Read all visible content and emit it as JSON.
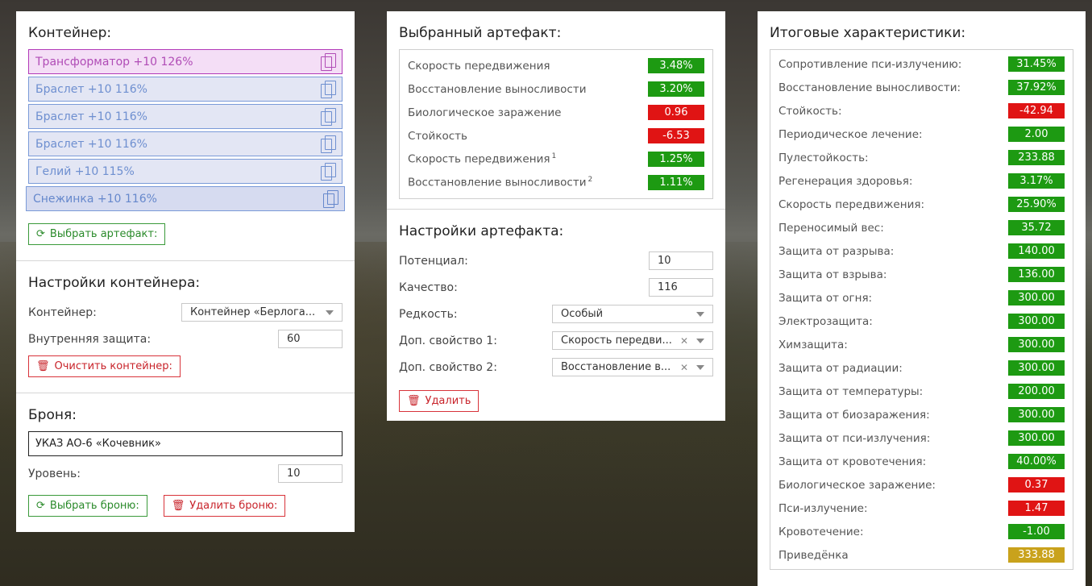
{
  "container_panel": {
    "title": "Контейнер:",
    "slots": [
      {
        "label": "Трансформатор +10 126%",
        "kind": "transformer"
      },
      {
        "label": "Браслет +10 116%",
        "kind": "normal"
      },
      {
        "label": "Браслет +10 116%",
        "kind": "normal"
      },
      {
        "label": "Браслет +10 116%",
        "kind": "normal"
      },
      {
        "label": "Гелий +10 115%",
        "kind": "normal"
      },
      {
        "label": "Снежинка +10 116%",
        "kind": "shifted"
      }
    ],
    "select_artifact_label": "Выбрать артефакт:",
    "settings_title": "Настройки контейнера:",
    "container_label": "Контейнер:",
    "container_value": "Контейнер «Берлога...",
    "inner_protection_label": "Внутренняя защита:",
    "inner_protection_value": "60",
    "clear_label": "Очистить контейнер:",
    "armor_title": "Броня:",
    "armor_value": "УКАЗ АО-6 «Кочевник»",
    "level_label": "Уровень:",
    "level_value": "10",
    "select_armor_label": "Выбрать броню:",
    "delete_armor_label": "Удалить броню:"
  },
  "selected_artifact": {
    "title": "Выбранный артефакт:",
    "stats": [
      {
        "name": "Скорость передвижения",
        "sup": "",
        "value": "3.48%",
        "color": "green"
      },
      {
        "name": "Восстановление выносливости",
        "sup": "",
        "value": "3.20%",
        "color": "green"
      },
      {
        "name": "Биологическое заражение",
        "sup": "",
        "value": "0.96",
        "color": "red"
      },
      {
        "name": "Стойкость",
        "sup": "",
        "value": "-6.53",
        "color": "red"
      },
      {
        "name": "Скорость передвижения",
        "sup": "1",
        "value": "1.25%",
        "color": "green"
      },
      {
        "name": "Восстановление выносливости",
        "sup": "2",
        "value": "1.11%",
        "color": "green"
      }
    ],
    "settings_title": "Настройки артефакта:",
    "potential_label": "Потенциал:",
    "potential_value": "10",
    "quality_label": "Качество:",
    "quality_value": "116",
    "rarity_label": "Редкость:",
    "rarity_value": "Особый",
    "extra1_label": "Доп. свойство 1:",
    "extra1_value": "Скорость передви...",
    "extra2_label": "Доп. свойство 2:",
    "extra2_value": "Восстановление в...",
    "delete_label": "Удалить"
  },
  "totals": {
    "title": "Итоговые характеристики:",
    "stats": [
      {
        "name": "Сопротивление пси-излучению:",
        "value": "31.45%",
        "color": "green"
      },
      {
        "name": "Восстановление выносливости:",
        "value": "37.92%",
        "color": "green"
      },
      {
        "name": "Стойкость:",
        "value": "-42.94",
        "color": "red"
      },
      {
        "name": "Периодическое лечение:",
        "value": "2.00",
        "color": "green"
      },
      {
        "name": "Пулестойкость:",
        "value": "233.88",
        "color": "green"
      },
      {
        "name": "Регенерация здоровья:",
        "value": "3.17%",
        "color": "green"
      },
      {
        "name": "Скорость передвижения:",
        "value": "25.90%",
        "color": "green"
      },
      {
        "name": "Переносимый вес:",
        "value": "35.72",
        "color": "green"
      },
      {
        "name": "Защита от разрыва:",
        "value": "140.00",
        "color": "green"
      },
      {
        "name": "Защита от взрыва:",
        "value": "136.00",
        "color": "green"
      },
      {
        "name": "Защита от огня:",
        "value": "300.00",
        "color": "green"
      },
      {
        "name": "Электрозащита:",
        "value": "300.00",
        "color": "green"
      },
      {
        "name": "Химзащита:",
        "value": "300.00",
        "color": "green"
      },
      {
        "name": "Защита от радиации:",
        "value": "300.00",
        "color": "green"
      },
      {
        "name": "Защита от температуры:",
        "value": "200.00",
        "color": "green"
      },
      {
        "name": "Защита от биозаражения:",
        "value": "300.00",
        "color": "green"
      },
      {
        "name": "Защита от пси-излучения:",
        "value": "300.00",
        "color": "green"
      },
      {
        "name": "Защита от кровотечения:",
        "value": "40.00%",
        "color": "green"
      },
      {
        "name": "Биологическое заражение:",
        "value": "0.37",
        "color": "red"
      },
      {
        "name": "Пси-излучение:",
        "value": "1.47",
        "color": "red"
      },
      {
        "name": "Кровотечение:",
        "value": "-1.00",
        "color": "green"
      },
      {
        "name": "Приведёнка",
        "value": "333.88",
        "color": "gold"
      }
    ]
  },
  "colors": {
    "green": "#1d9a12",
    "red": "#e01414",
    "gold": "#c9a21c",
    "slot_blue": "#7a9ad8",
    "slot_purple": "#b23ab8"
  }
}
